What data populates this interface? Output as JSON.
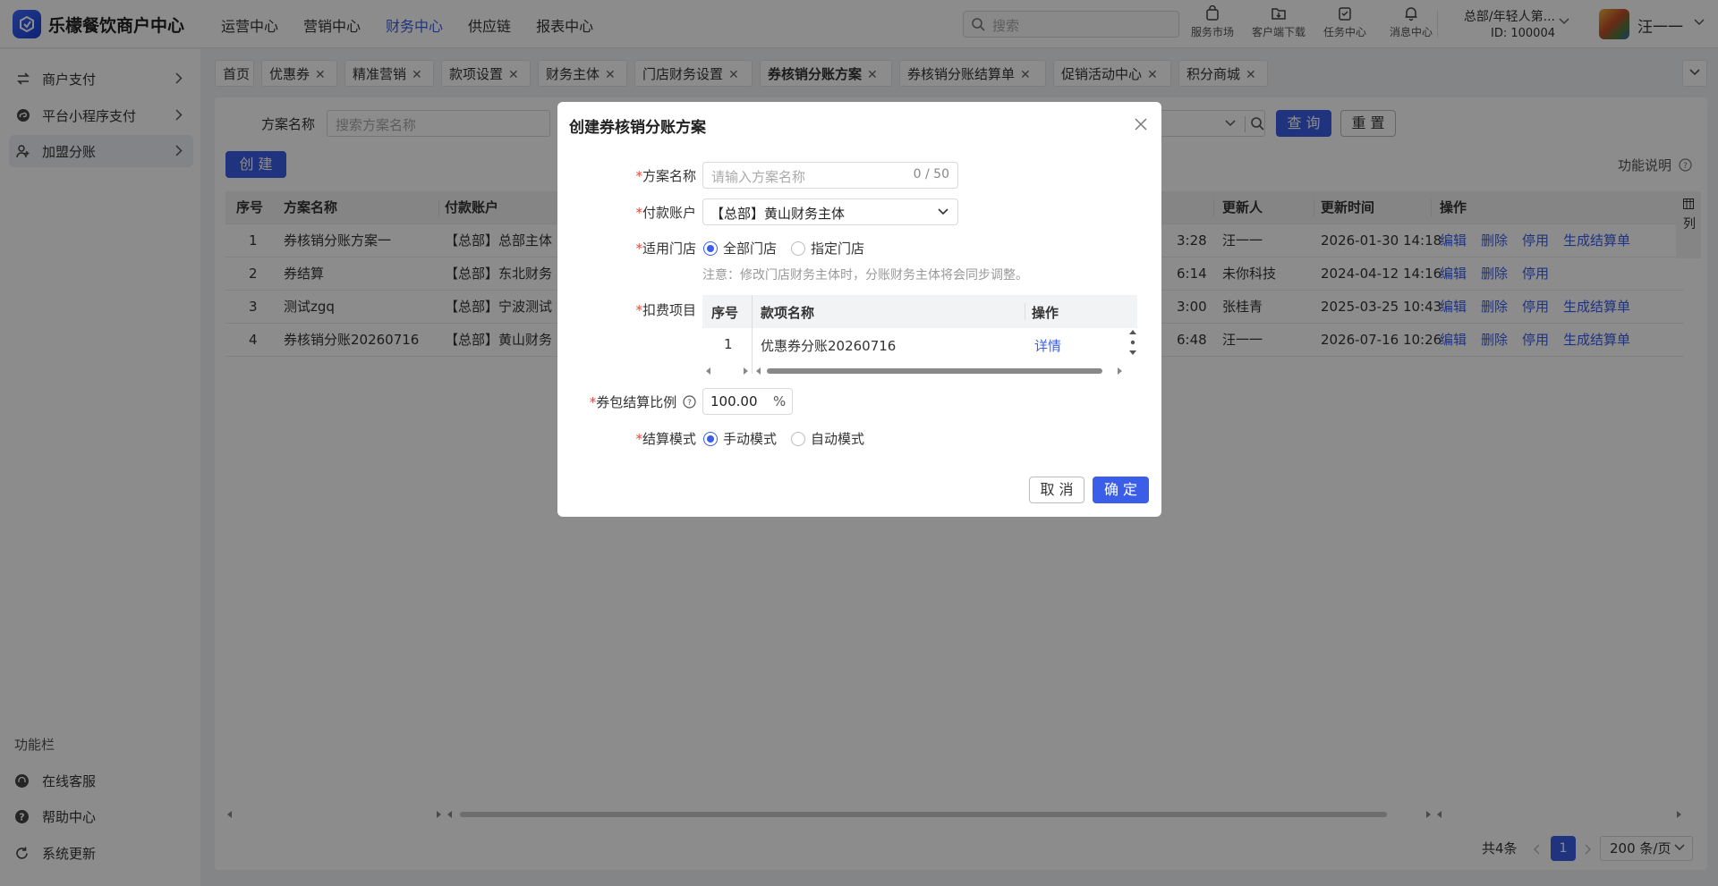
{
  "app": {
    "brand": "乐檬餐饮商户中心"
  },
  "topnav": [
    "运营中心",
    "营销中心",
    "财务中心",
    "供应链",
    "报表中心"
  ],
  "search": {
    "placeholder": "搜索"
  },
  "tools": [
    "服务市场",
    "客户端下载",
    "任务中心",
    "消息中心"
  ],
  "org": {
    "name": "总部/年轻人第...",
    "id": "ID: 100004"
  },
  "user": {
    "name": "汪一一"
  },
  "sidebar": {
    "items": [
      "商户支付",
      "平台小程序支付",
      "加盟分账"
    ],
    "func_title": "功能栏",
    "bottom": [
      "在线客服",
      "帮助中心",
      "系统更新"
    ]
  },
  "tabs": [
    "首页",
    "优惠券",
    "精准营销",
    "款项设置",
    "财务主体",
    "门店财务设置",
    "券核销分账方案",
    "券核销分账结算单",
    "促销活动中心",
    "积分商城"
  ],
  "filter": {
    "label": "方案名称",
    "placeholder": "搜索方案名称",
    "query": "查 询",
    "reset": "重 置",
    "create": "创 建",
    "func_desc": "功能说明"
  },
  "table": {
    "headers": [
      "序号",
      "方案名称",
      "付款账户",
      "更新人",
      "更新时间",
      "操作"
    ],
    "rows": [
      {
        "no": "1",
        "name": "券核销分账方案一",
        "account": "【总部】总部主体",
        "time_frag": "3:28",
        "updater": "汪一一",
        "updated": "2026-01-30 14:18",
        "ops": [
          "编辑",
          "删除",
          "停用",
          "生成结算单"
        ]
      },
      {
        "no": "2",
        "name": "券结算",
        "account": "【总部】东北财务",
        "time_frag": "6:14",
        "updater": "未你科技",
        "updated": "2024-04-12 14:16",
        "ops": [
          "编辑",
          "删除",
          "停用"
        ]
      },
      {
        "no": "3",
        "name": "测试zgq",
        "account": "【总部】宁波测试",
        "time_frag": "3:00",
        "updater": "张桂青",
        "updated": "2025-03-25 10:43",
        "ops": [
          "编辑",
          "删除",
          "停用",
          "生成结算单"
        ]
      },
      {
        "no": "4",
        "name": "券核销分账20260716",
        "account": "【总部】黄山财务",
        "time_frag": "6:48",
        "updater": "汪一一",
        "updated": "2026-07-16 10:26",
        "ops": [
          "编辑",
          "删除",
          "停用",
          "生成结算单"
        ]
      }
    ],
    "col_toggle": "列"
  },
  "pager": {
    "total": "共4条",
    "current": "1",
    "size": "200 条/页"
  },
  "modal": {
    "title": "创建券核销分账方案",
    "fields": {
      "name_label": "方案名称",
      "name_placeholder": "请输入方案名称",
      "name_count": "0 / 50",
      "account_label": "付款账户",
      "account_value": "【总部】黄山财务主体",
      "store_label": "适用门店",
      "store_all": "全部门店",
      "store_specific": "指定门店",
      "note": "注意：修改门店财务主体时，分账财务主体将会同步调整。",
      "fee_label": "扣费项目",
      "ratio_label": "券包结算比例",
      "ratio_value": "100.00",
      "ratio_unit": "%",
      "mode_label": "结算模式",
      "mode_manual": "手动模式",
      "mode_auto": "自动模式"
    },
    "fee_table": {
      "headers": [
        "序号",
        "款项名称",
        "操作"
      ],
      "rows": [
        {
          "no": "1",
          "name": "优惠券分账20260716",
          "op": "详情"
        }
      ]
    },
    "cancel": "取 消",
    "ok": "确 定"
  }
}
